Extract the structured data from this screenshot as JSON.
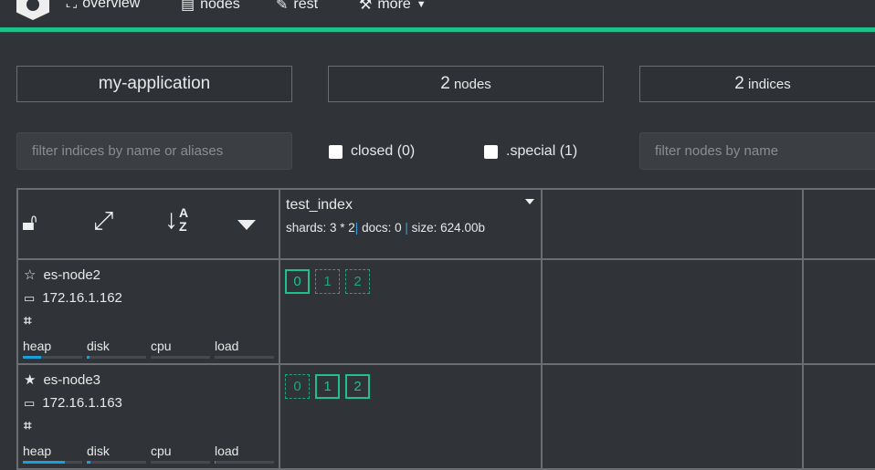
{
  "nav": {
    "items": [
      {
        "label": "overview",
        "icon": "sitemap-icon"
      },
      {
        "label": "nodes",
        "icon": "server-icon"
      },
      {
        "label": "rest",
        "icon": "edit-icon"
      },
      {
        "label": "more",
        "icon": "wrench-icon"
      }
    ]
  },
  "accent": "#1fc18a",
  "stats": {
    "cluster": "my-application",
    "nodes_count": "2",
    "nodes_label": "nodes",
    "indices_count": "2",
    "indices_label": "indices"
  },
  "filters": {
    "indices_placeholder": "filter indices by name or aliases",
    "closed_label": "closed (0)",
    "special_label": ".special (1)",
    "nodes_placeholder": "filter nodes by name"
  },
  "index": {
    "name": "test_index",
    "shards": "shards: 3 * 2",
    "docs": "docs: 0",
    "size": "size: 624.00b"
  },
  "metric_labels": [
    "heap",
    "disk",
    "cpu",
    "load"
  ],
  "nodes": [
    {
      "name": "es-node2",
      "ip": "172.16.1.162",
      "master": false,
      "metrics": [
        30,
        5,
        0,
        0
      ],
      "shards": [
        {
          "n": "0",
          "type": "primary"
        },
        {
          "n": "1",
          "type": "replica"
        },
        {
          "n": "2",
          "type": "replica"
        }
      ]
    },
    {
      "name": "es-node3",
      "ip": "172.16.1.163",
      "master": true,
      "metrics": [
        70,
        6,
        0,
        2
      ],
      "shards": [
        {
          "n": "0",
          "type": "replica"
        },
        {
          "n": "1",
          "type": "primary"
        },
        {
          "n": "2",
          "type": "primary"
        }
      ]
    }
  ]
}
